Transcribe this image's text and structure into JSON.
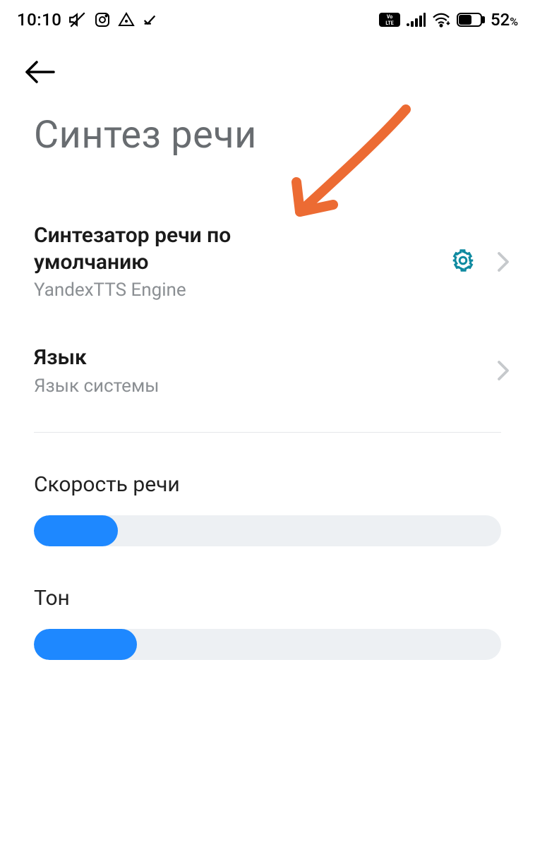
{
  "status": {
    "time": "10:10",
    "volte": "LTE",
    "battery_pct": "52",
    "battery_sym": "%"
  },
  "page_title": "Синтез речи",
  "items": {
    "engine": {
      "label": "Синтезатор речи по\nумолчанию",
      "sub": "YandexTTS Engine"
    },
    "language": {
      "label": "Язык",
      "sub": "Язык системы"
    }
  },
  "sliders": {
    "rate": {
      "label": "Скорость речи",
      "percent": 18
    },
    "pitch": {
      "label": "Тон",
      "percent": 22
    }
  },
  "annotation": {
    "color": "#ec6b33"
  }
}
